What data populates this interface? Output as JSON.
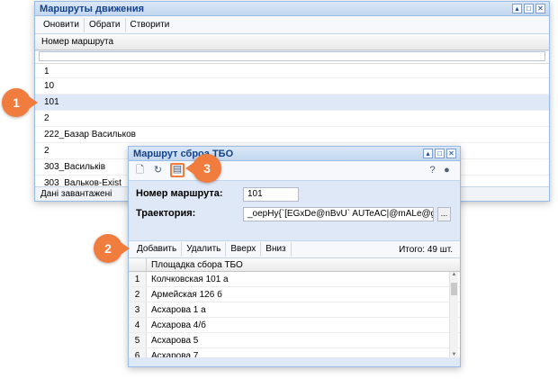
{
  "window_routes": {
    "title": "Маршруты движения",
    "toolbar": [
      "Оновити",
      "Обрати",
      "Створити"
    ],
    "column": "Номер маршрута",
    "rows": [
      "1",
      "10",
      "101",
      "2",
      "222_Базар Васильков",
      "2",
      "303_Васильків",
      "303_Вальков-Exist"
    ],
    "selected_index": 2,
    "status": "Дані завантажені"
  },
  "window_collection": {
    "title": "Маршрут сброа ТБО",
    "route_label": "Номер маршрута:",
    "route_value": "101",
    "trajectory_label": "Траектория:",
    "trajectory_value": "_oepHy{`[EGxDe@nBvU` AUTeAC|@mALe@gFq...",
    "trajectory_button": "...",
    "toolbar": [
      "Добавить",
      "Удалить",
      "Вверх",
      "Вниз"
    ],
    "total": "Итого: 49 шт.",
    "column": "Площадка сбора ТБО",
    "rows": [
      {
        "num": "1",
        "name": "Колчковская 101 а"
      },
      {
        "num": "2",
        "name": "Армейская 126 б"
      },
      {
        "num": "3",
        "name": "Асхарова 1 а"
      },
      {
        "num": "4",
        "name": "Асхарова 4/б"
      },
      {
        "num": "5",
        "name": "Асхарова 5"
      },
      {
        "num": "6",
        "name": "Асхарова 7"
      }
    ]
  },
  "callouts": [
    "1",
    "2",
    "3"
  ],
  "accent_color": "#f07c3e",
  "icons": [
    "minimize-icon",
    "maximize-icon",
    "close-icon",
    "new-document-icon",
    "refresh-icon",
    "save-icon",
    "help-icon",
    "chat-icon"
  ]
}
